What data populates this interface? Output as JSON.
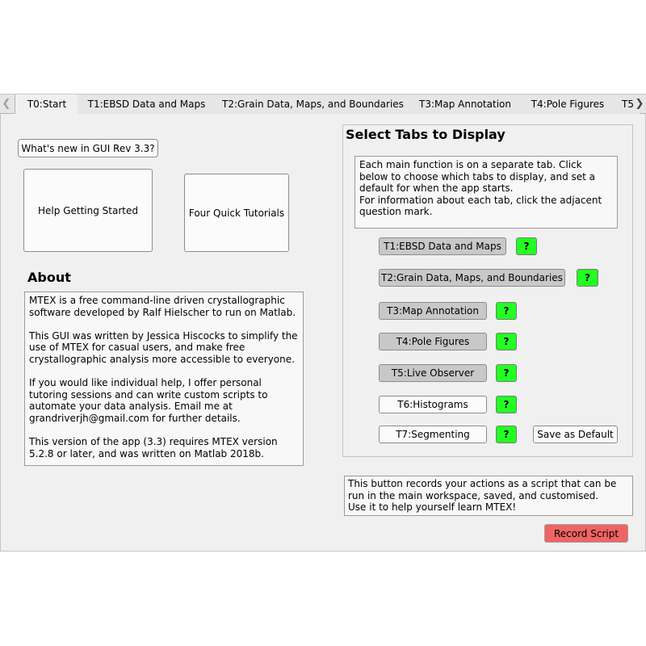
{
  "tabs": [
    {
      "label": "T0:Start"
    },
    {
      "label": "T1:EBSD Data and Maps"
    },
    {
      "label": "T2:Grain Data, Maps, and Boundaries"
    },
    {
      "label": "T3:Map Annotation"
    },
    {
      "label": "T4:Pole Figures"
    },
    {
      "label": "T5"
    }
  ],
  "left": {
    "whats_new": "What's new in GUI Rev 3.3?",
    "help_getting_started": "Help Getting Started",
    "quick_tutorials": "Four Quick Tutorials",
    "about_title": "About",
    "about_text": "MTEX is a free command-line driven crystallographic software developed by Ralf Hielscher to run on Matlab.\n\nThis GUI was written by Jessica Hiscocks to simplify the use of MTEX for casual users, and make free crystallographic analysis more accessible to everyone.\n\nIf you would like individual help, I offer personal tutoring sessions and can write custom scripts to automate your data analysis.  Email me at grandriverjh@gmail.com for further details.\n\nThis version of the app (3.3) requires MTEX version 5.2.8 or later, and was written on Matlab 2018b."
  },
  "select_tabs": {
    "title": "Select Tabs to Display",
    "info": "Each main function is on a separate tab. Click below to choose which tabs to display, and set a default for when the app starts.\nFor information about each  tab, click the adjacent question mark.",
    "items": [
      {
        "label": "T1:EBSD Data and Maps",
        "q": "?"
      },
      {
        "label": "T2:Grain Data, Maps, and Boundaries",
        "q": "?"
      },
      {
        "label": "T3:Map Annotation",
        "q": "?"
      },
      {
        "label": "T4:Pole Figures",
        "q": "?"
      },
      {
        "label": "T5:Live Observer",
        "q": "?"
      },
      {
        "label": "T6:Histograms",
        "q": "?"
      },
      {
        "label": "T7:Segmenting",
        "q": "?"
      }
    ],
    "save_default": "Save as Default"
  },
  "record": {
    "info": "This button records your actions as a script that can be run in the main workspace, saved, and customised.\nUse it to help yourself learn MTEX!",
    "button": "Record Script"
  },
  "colors": {
    "question_green": "#22ff22",
    "record_red": "#f06464"
  }
}
